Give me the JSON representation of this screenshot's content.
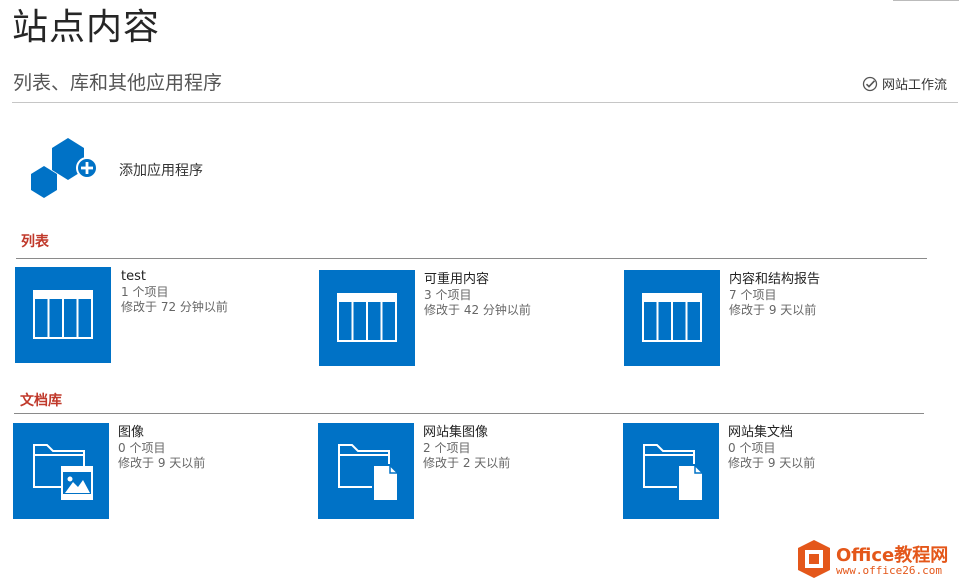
{
  "header": {
    "title": "站点内容",
    "subtitle": "列表、库和其他应用程序",
    "workflow_label": "网站工作流"
  },
  "add_app": {
    "label": "添加应用程序"
  },
  "sections": [
    {
      "title": "列表",
      "items": [
        {
          "name": "test",
          "count": "1 个项目",
          "modified": "修改于 72 分钟以前"
        },
        {
          "name": "可重用内容",
          "count": "3 个项目",
          "modified": "修改于 42 分钟以前"
        },
        {
          "name": "内容和结构报告",
          "count": "7 个项目",
          "modified": "修改于 9 天以前"
        }
      ]
    },
    {
      "title": "文档库",
      "items": [
        {
          "name": "图像",
          "count": "0 个项目",
          "modified": "修改于 9 天以前"
        },
        {
          "name": "网站集图像",
          "count": "2 个项目",
          "modified": "修改于 2 天以前"
        },
        {
          "name": "网站集文档",
          "count": "0 个项目",
          "modified": "修改于 9 天以前"
        }
      ]
    }
  ],
  "watermark": {
    "brand": "Office教程网",
    "url": "www.office26.com"
  },
  "colors": {
    "tile": "#0072c6",
    "section_title": "#c0392b",
    "logo": "#e4571a"
  }
}
